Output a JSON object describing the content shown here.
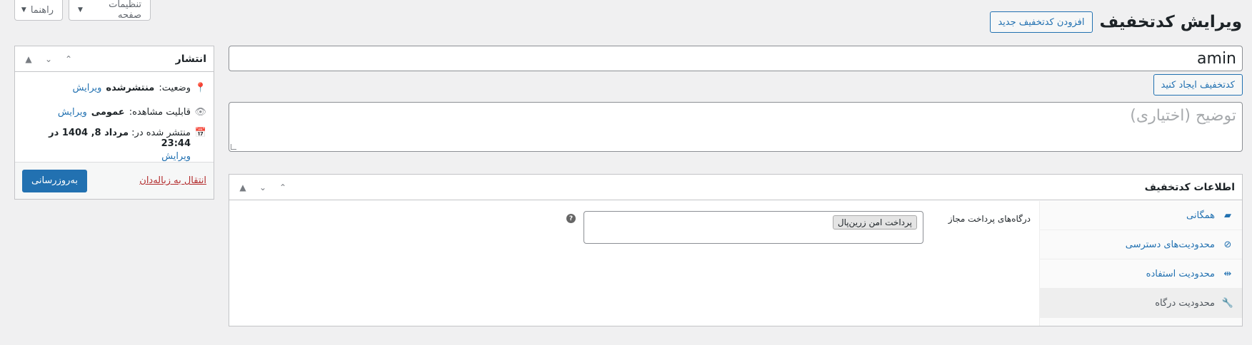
{
  "screen_tabs": {
    "options": "تنظیمات صفحه",
    "help": "راهنما"
  },
  "header": {
    "title": "ویرایش کدتخفیف",
    "add_new": "افزودن کدتخفیف جدید"
  },
  "coupon_code": {
    "value": "amin",
    "generate": "کدتخفیف ایجاد کنید"
  },
  "description": {
    "placeholder": "توضیح (اختیاری)"
  },
  "publish": {
    "title": "انتشار",
    "status_label": "وضعیت:",
    "status_value": "منتشرشده",
    "status_edit": "ویرایش",
    "visibility_label": "قابلیت مشاهده:",
    "visibility_value": "عمومی",
    "visibility_edit": "ویرایش",
    "published_label": "منتشر شده در:",
    "published_value": "مرداد 8, 1404 در 23:44",
    "published_edit": "ویرایش",
    "trash": "انتقال به زباله‌دان",
    "update": "به‌روزرسانی"
  },
  "coupon_data": {
    "title": "اطلاعات کدتخفیف",
    "tabs": [
      {
        "label": "همگانی",
        "icon": "ticket-icon"
      },
      {
        "label": "محدودیت‌های دسترسی",
        "icon": "ban-icon"
      },
      {
        "label": "محدودیت استفاده",
        "icon": "limits-icon"
      },
      {
        "label": "محدودیت درگاه",
        "icon": "wrench-icon"
      }
    ],
    "active_tab": 3,
    "gateways_label": "درگاه‌های پرداخت مجاز",
    "gateway_selected": "پرداخت امن زرین‌پال",
    "help": "?"
  },
  "colors": {
    "accent": "#2271b1",
    "danger": "#b32d2e",
    "background": "#f0f0f1"
  }
}
